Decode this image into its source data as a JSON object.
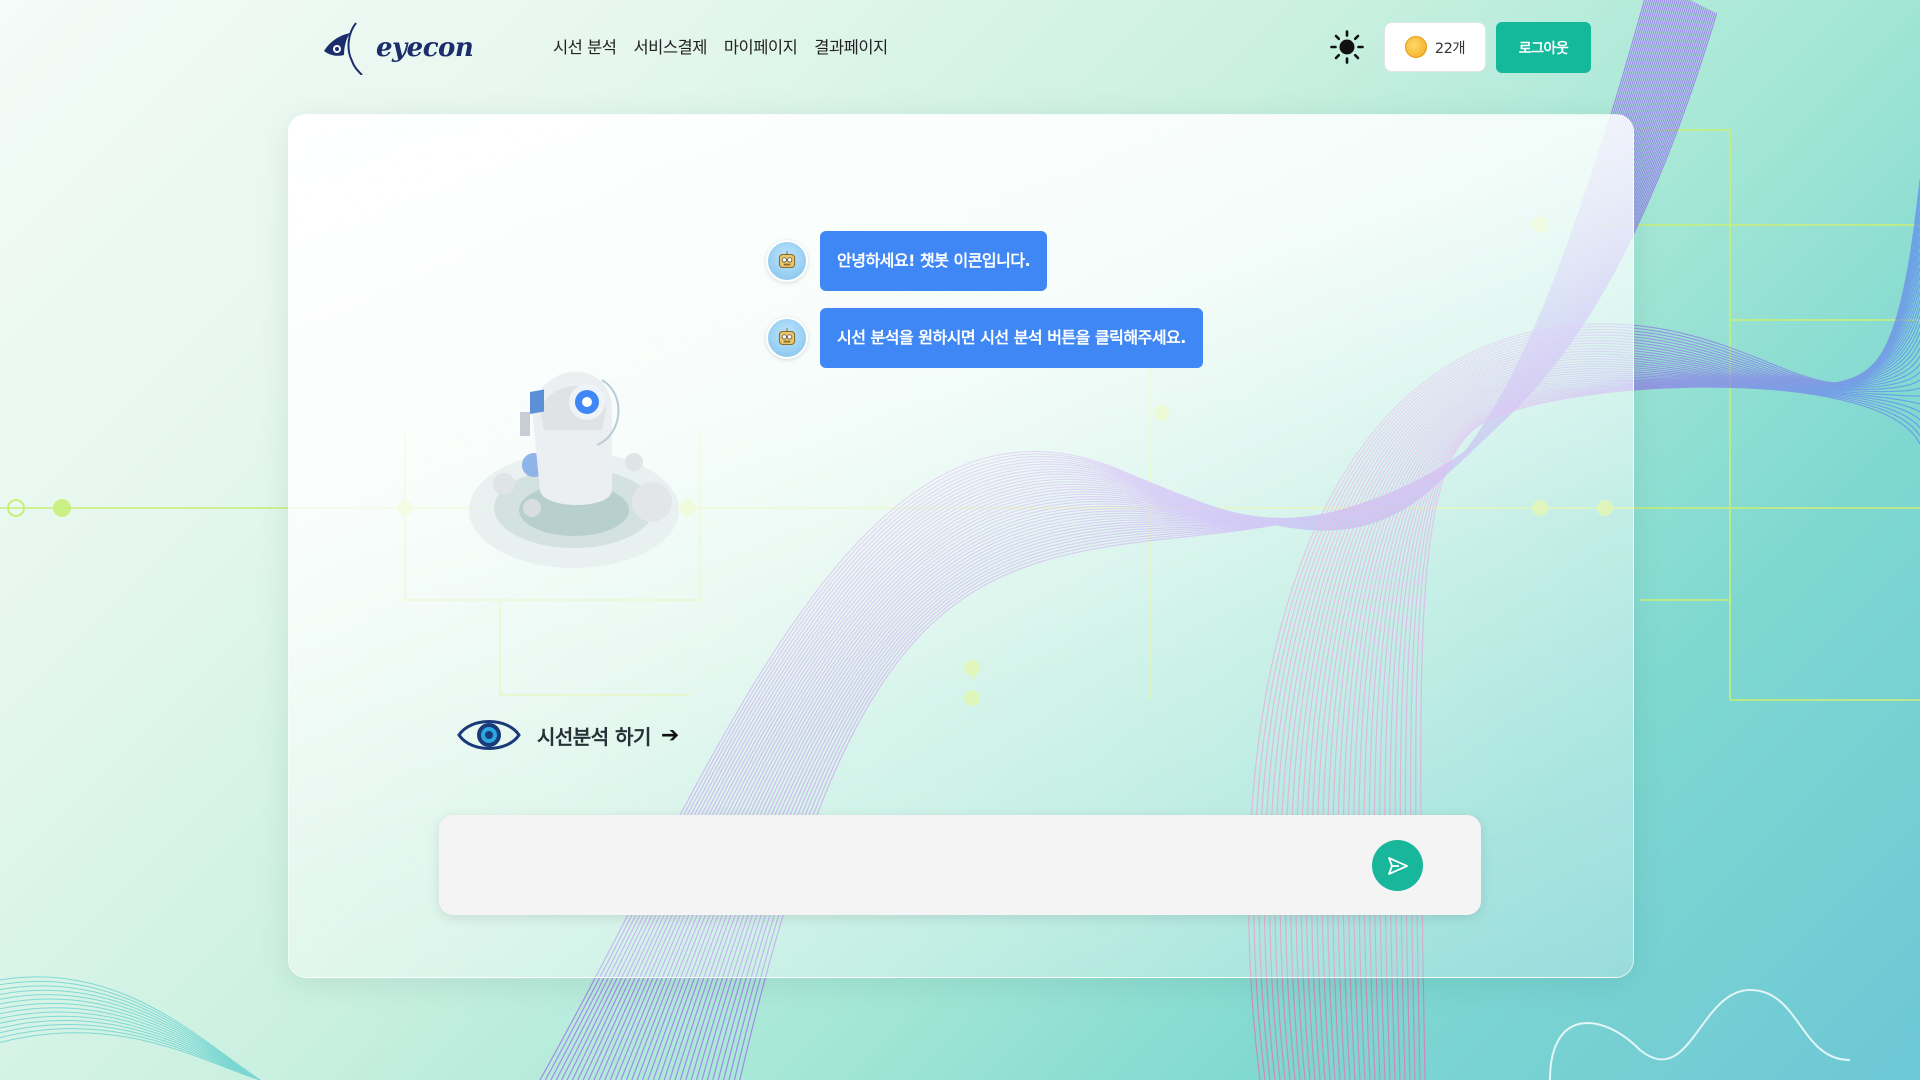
{
  "header": {
    "logo_text": "eyecon",
    "nav": [
      "시선 분석",
      "서비스결제",
      "마이페이지",
      "결과페이지"
    ],
    "coin_count": "22개",
    "logout_label": "로그아웃"
  },
  "chat": {
    "messages": [
      "안녕하세요! 챗봇 이콘입니다.",
      "시선 분석을 원하시면 시선 분석 버튼을 클릭해주세요."
    ],
    "input_value": ""
  },
  "analyze_link_label": "시선분석 하기",
  "icons": {
    "logo": "eye-logo-icon",
    "theme": "sun-icon",
    "coin": "coin-icon",
    "bot": "robot-avatar-icon",
    "eye": "eye-icon",
    "arrow": "arrow-right-icon",
    "send": "send-icon"
  },
  "colors": {
    "primary": "#14b99c",
    "bubble": "#3f87f5",
    "logo": "#1b2e6b",
    "wave_pink": "#f06bb0",
    "wave_blue": "#5a8cf0",
    "wave_teal": "#3cc3c8",
    "circuit": "#c8ef7a"
  }
}
